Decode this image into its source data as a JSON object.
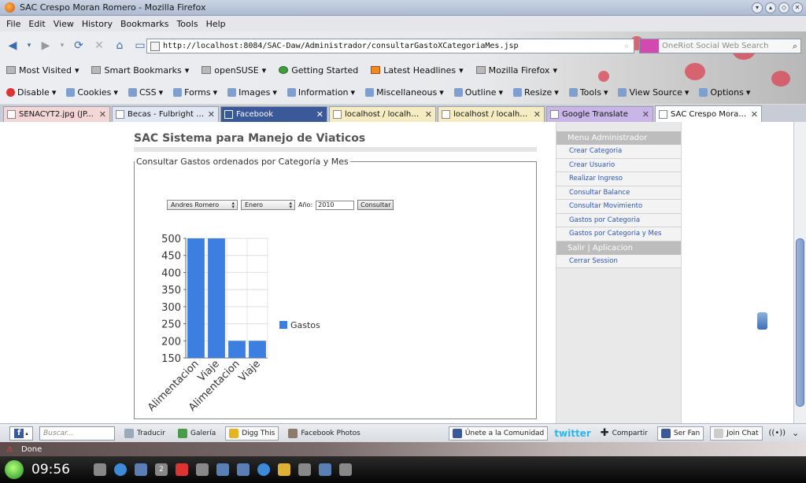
{
  "window": {
    "title": "SAC Crespo Moran Romero - Mozilla Firefox"
  },
  "menu": [
    "File",
    "Edit",
    "View",
    "History",
    "Bookmarks",
    "Tools",
    "Help"
  ],
  "navigation": {
    "url": "http://localhost:8084/SAC-Daw/Administrador/consultarGastoXCategoriaMes.jsp",
    "search_placeholder": "OneRiot Social Web Search"
  },
  "bookmarks": [
    "Most Visited",
    "Smart Bookmarks",
    "openSUSE",
    "Getting Started",
    "Latest Headlines",
    "Mozilla Firefox"
  ],
  "webdev_toolbar": [
    "Disable",
    "Cookies",
    "CSS",
    "Forms",
    "Images",
    "Information",
    "Miscellaneous",
    "Outline",
    "Resize",
    "Tools",
    "View Source",
    "Options"
  ],
  "tabs": [
    {
      "label": "SENACYT2.jpg (JP...",
      "style": "pink"
    },
    {
      "label": "Becas - Fulbright - y...",
      "style": "blue"
    },
    {
      "label": "Facebook",
      "style": "fb"
    },
    {
      "label": "localhost / localhos...",
      "style": "yellow"
    },
    {
      "label": "localhost / localhos...",
      "style": "yellow"
    },
    {
      "label": "Google Translate",
      "style": "purple"
    },
    {
      "label": "SAC Crespo Moran...",
      "style": "active"
    }
  ],
  "page": {
    "title": "SAC Sistema para Manejo de Viaticos",
    "fieldset_legend": "Consultar Gastos ordenados por Categoría y Mes",
    "filters": {
      "user": "Andres Romero",
      "month": "Enero",
      "year_label": "Año:",
      "year_value": "2010",
      "submit": "Consultar"
    }
  },
  "sidebar": {
    "menu_title": "Menu Administrador",
    "items": [
      "Crear Categoria",
      "Crear Usuario",
      "Realizar Ingreso",
      "Consultar Balance",
      "Consultar Movimiento",
      "Gastos por Categoria",
      "Gastos por Categoria y Mes"
    ],
    "section2_title": "Salir | Aplicacion",
    "section2_items": [
      "Cerrar Session"
    ]
  },
  "chart_data": {
    "type": "bar",
    "categories": [
      "Alimentacion",
      "Viaje",
      "Alimentacion",
      "Viaje"
    ],
    "series": [
      {
        "name": "Gastos",
        "values": [
          500,
          500,
          200,
          200
        ],
        "color": "#3d7fe0"
      }
    ],
    "ylim": [
      150,
      500
    ],
    "yticks": [
      150,
      200,
      250,
      300,
      350,
      400,
      450,
      500
    ],
    "legend": "right",
    "grid": true
  },
  "addon_bar": {
    "search_placeholder": "Buscar...",
    "items": [
      "Traducir",
      "Galería",
      "Digg This",
      "Facebook Photos"
    ],
    "community": "Únete a la Comunidad",
    "twitter": "twitter",
    "share": "Compartir",
    "fan": "Ser Fan",
    "chat": "Join Chat"
  },
  "status": {
    "text": "Done"
  },
  "taskbar": {
    "clock": "09:56",
    "desktop": "2"
  }
}
